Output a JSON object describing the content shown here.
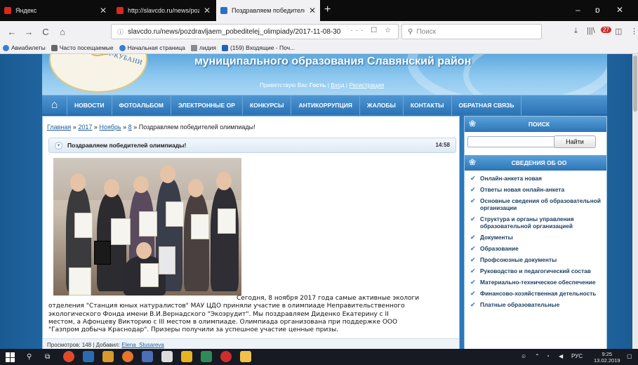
{
  "browser": {
    "tabs": [
      {
        "title": "Яндекс",
        "favicon": "yandex-icon",
        "active": false
      },
      {
        "title": "http://slavcdo.ru/news/pozdra",
        "favicon": "yandex-icon",
        "active": false
      },
      {
        "title": "Поздравляем победителей о",
        "favicon": "site-icon",
        "active": true
      }
    ],
    "new_tab": "+",
    "window_controls": {
      "minimize": "–",
      "maximize": "ɒ",
      "close": "✕"
    },
    "nav": {
      "back": "←",
      "forward": "→",
      "reload": "C",
      "home": "⌂"
    },
    "url_info": "ⓘ",
    "url": "slavcdo.ru/news/pozdravljaem_pobeditelej_olimpiady/2017-11-08-30",
    "url_tools": "··· ☐ ☆",
    "search_placeholder": "Поиск",
    "right_tools": {
      "download": "⤓",
      "library": "|||\\",
      "addon": "27",
      "sidebar": "◫",
      "menu": "⋮"
    },
    "bookmarks": [
      {
        "label": "Авиабилеты",
        "icon": "globe-icon"
      },
      {
        "label": "Часто посещаемые",
        "icon": "gear-icon"
      },
      {
        "label": "Начальная страница",
        "icon": "globe-icon"
      },
      {
        "label": "лидия",
        "icon": "folder-icon"
      },
      {
        "label": "(159) Входящие - Поч...",
        "icon": "mail-icon"
      }
    ]
  },
  "site": {
    "logo_text": "СЛАВЯНСК-НА-КУБАНИ",
    "title": "муниципального образования Славянский район",
    "welcome_prefix": "Приветствую Вас",
    "guest": "Гость",
    "login": "Вход",
    "register": "Регистрация",
    "separator": "|",
    "menu": [
      "НОВОСТИ",
      "ФОТОАЛЬБОМ",
      "ЭЛЕКТРОННЫЕ ОР",
      "КОНКУРСЫ",
      "АНТИКОРРУПЦИЯ",
      "ЖАЛОБЫ",
      "КОНТАКТЫ",
      "ОБРАТНАЯ СВЯЗЬ"
    ]
  },
  "article": {
    "breadcrumb": {
      "home": "Главная",
      "year": "2017",
      "month": "Ноябрь",
      "day": "8",
      "sep": "»",
      "current": "Поздравляем победителей олимпиады!"
    },
    "title": "Поздравляем победителей олимпиады!",
    "time": "14:58",
    "lines": [
      "Сегодня, 8 ноября 2017 года  самые активные экологи",
      "отделения \"Станция юных натуралистов\" МАУ ЦДО приняли участие в олимпиаде Неправительственного",
      "экологического Фонда имени В.И.Вернадского \"Экоэрудит\".  Мы поздравляем Диденко Екатерину с II",
      "местом, а Афонцеву Викторию с III местом в олимпиаде. Олимпиада организована при поддержке ООО",
      "\"Газпром добыча Краснодар\". Призеры получили за успешное участие ценные призы."
    ],
    "views_label": "Просмотров:",
    "views": "148",
    "added_label": "Добавил:",
    "author": "Elena_Slusareva"
  },
  "sidebar": {
    "search_header": "ПОИСК",
    "search_button": "Найти",
    "info_header": "СВЕДЕНИЯ ОБ ОО",
    "links": [
      "Онлайн-анкета новая",
      "Ответы новая онлайн-анкета",
      "Основные сведения об образовательной организации",
      "Структура и органы управления образовательной организацией",
      "Документы",
      "Образование",
      "Профсоюзные документы",
      "Руководство и педагогический состав",
      "Материально-техническое обеспечение",
      "Финансово-хозяйственная детельность",
      "Платные образовательные"
    ]
  },
  "taskbar": {
    "language": "РУС",
    "time": "9:25",
    "date": "13.02.2019"
  },
  "colors": {
    "page_bg": "#2f80c2",
    "menu_bg": "#2c73b5",
    "link": "#1d5e9a",
    "check": "#4b8fd0"
  }
}
